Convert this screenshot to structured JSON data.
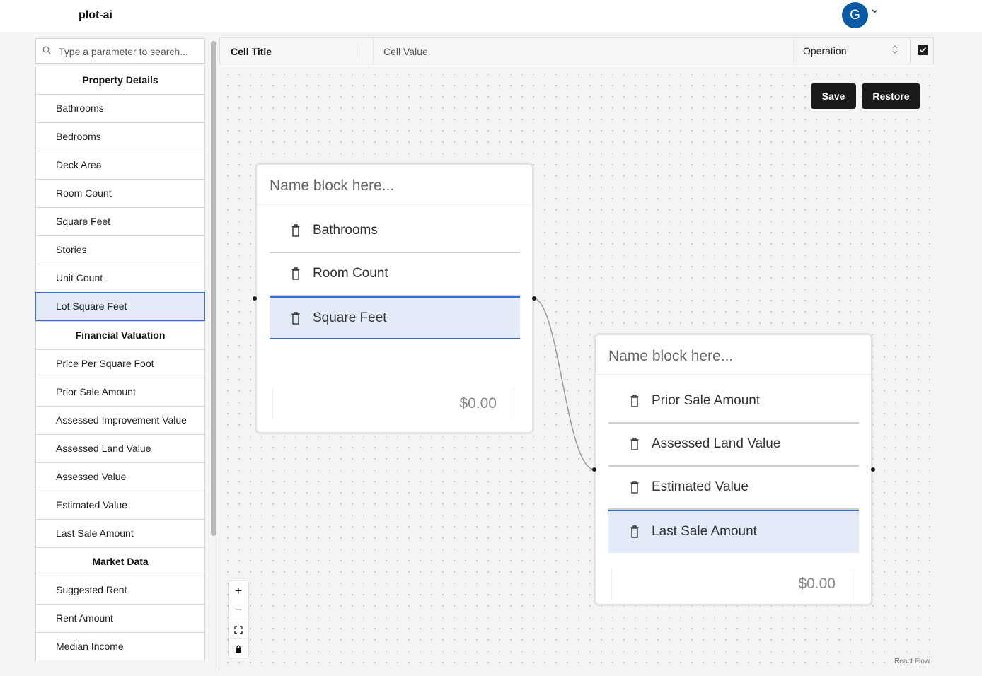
{
  "app": {
    "title": "plot-ai",
    "avatar_initial": "G"
  },
  "sidebar": {
    "search_placeholder": "Type a parameter to search...",
    "groups": [
      {
        "title": "Property Details",
        "items": [
          "Bathrooms",
          "Bedrooms",
          "Deck Area",
          "Room Count",
          "Square Feet",
          "Stories",
          "Unit Count",
          "Lot Square Feet"
        ]
      },
      {
        "title": "Financial Valuation",
        "items": [
          "Price Per Square Foot",
          "Prior Sale Amount",
          "Assessed Improvement Value",
          "Assessed Land Value",
          "Assessed Value",
          "Estimated Value",
          "Last Sale Amount"
        ]
      },
      {
        "title": "Market Data",
        "items": [
          "Suggested Rent",
          "Rent Amount",
          "Median Income"
        ]
      }
    ],
    "selected_item": "Lot Square Feet"
  },
  "cellbar": {
    "title": "Cell Title",
    "value_placeholder": "Cell Value",
    "operation": "Operation",
    "checked": true
  },
  "toolbar": {
    "save_label": "Save",
    "restore_label": "Restore"
  },
  "blocks": [
    {
      "name_placeholder": "Name block here...",
      "items": [
        "Bathrooms",
        "Room Count",
        "Square Feet"
      ],
      "selected": "Square Feet",
      "total": "$0.00"
    },
    {
      "name_placeholder": "Name block here...",
      "items": [
        "Prior Sale Amount",
        "Assessed Land Value",
        "Estimated Value",
        "Last Sale Amount"
      ],
      "selected": "Last Sale Amount",
      "total": "$0.00"
    }
  ],
  "controls": {
    "zoom_in": "+",
    "zoom_out": "−"
  },
  "attribution": "React Flow"
}
